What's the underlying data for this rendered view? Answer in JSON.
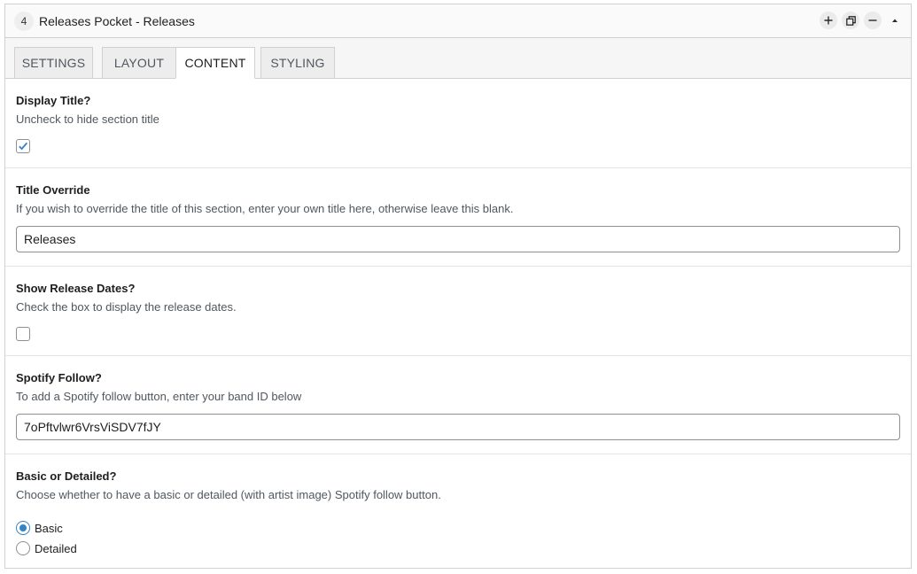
{
  "header": {
    "section_number": "4",
    "title": "Releases Pocket - Releases",
    "controls": [
      "plus-icon",
      "duplicate-icon",
      "minus-icon",
      "caret-up-icon"
    ]
  },
  "tabs": [
    {
      "label": "SETTINGS",
      "active": false
    },
    {
      "label": "LAYOUT",
      "active": false
    },
    {
      "label": "CONTENT",
      "active": true
    },
    {
      "label": "STYLING",
      "active": false
    }
  ],
  "fields": {
    "display_title": {
      "label": "Display Title?",
      "description": "Uncheck to hide section title",
      "checked": true
    },
    "title_override": {
      "label": "Title Override",
      "description": "If you wish to override the title of this section, enter your own title here, otherwise leave this blank.",
      "value": "Releases"
    },
    "show_release_dates": {
      "label": "Show Release Dates?",
      "description": "Check the box to display the release dates.",
      "checked": false
    },
    "spotify_follow": {
      "label": "Spotify Follow?",
      "description": "To add a Spotify follow button, enter your band ID below",
      "value": "7oPftvlwr6VrsViSDV7fJY"
    },
    "basic_or_detailed": {
      "label": "Basic or Detailed?",
      "description": "Choose whether to have a basic or detailed (with artist image) Spotify follow button.",
      "options": [
        {
          "label": "Basic",
          "checked": true
        },
        {
          "label": "Detailed",
          "checked": false
        }
      ]
    }
  },
  "colors": {
    "accent": "#3582c4",
    "border": "#d0d0d0",
    "description_text": "#50575e"
  }
}
